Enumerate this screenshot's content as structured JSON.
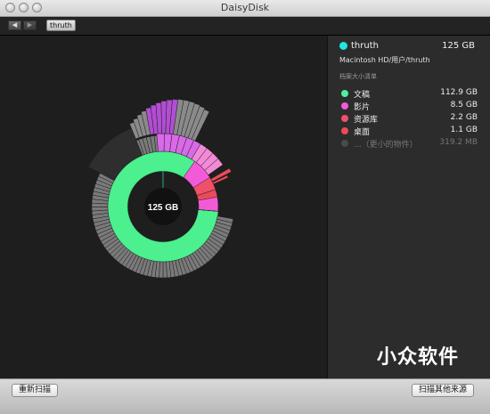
{
  "window": {
    "title": "DaisyDisk"
  },
  "toolbar": {
    "back_icon": "back-arrow-icon",
    "forward_icon": "forward-arrow-icon",
    "breadcrumb": "thruth"
  },
  "chart": {
    "center_label": "125 GB"
  },
  "sidebar": {
    "folder_name": "thruth",
    "folder_size": "125  GB",
    "folder_color": "#1fe7e0",
    "path": "Macintosh HD/用户/thruth",
    "section_title": "档案大小清单",
    "items": [
      {
        "label": "文稿",
        "size": "112.9 GB",
        "color": "#4df0a0"
      },
      {
        "label": "影片",
        "size": "8.5 GB",
        "color": "#f35ad8"
      },
      {
        "label": "资源库",
        "size": "2.2 GB",
        "color": "#f0506a"
      },
      {
        "label": "桌面",
        "size": "1.1 GB",
        "color": "#ec4a58"
      },
      {
        "label": "...（更小的物件）",
        "size": "319.2  MB",
        "color": "#4a4a4a"
      }
    ]
  },
  "watermark": "小众软件",
  "bottom": {
    "rescan_label": "重新扫描",
    "scan_other_label": "扫描其他来源"
  }
}
